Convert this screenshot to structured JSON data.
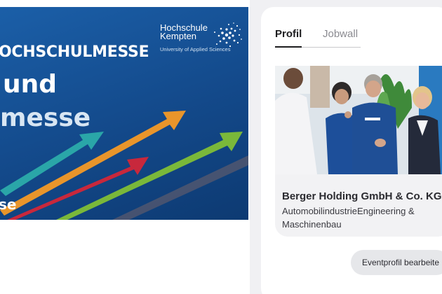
{
  "banner": {
    "heading": "OCHSCHULMESSE",
    "line1": "und",
    "line2": "messe",
    "bottom": "se",
    "logo": {
      "name": "Hochschule Kempten",
      "subtitle": "University of Applied Sciences"
    }
  },
  "tabs": [
    {
      "label": "Profil",
      "active": true
    },
    {
      "label": "Jobwall",
      "active": false
    }
  ],
  "company": {
    "name": "Berger Holding GmbH & Co. KG",
    "tags": "AutomobilindustrieEngineering & Maschinenbau"
  },
  "actions": {
    "edit_label": "Eventprofil bearbeite"
  },
  "colors": {
    "banner_blue": "#13498a",
    "card_bg": "#f2f2f4",
    "button_bg": "#e6e7ea",
    "arrow_orange": "#e8952b",
    "arrow_teal": "#2aa6a8",
    "arrow_red": "#c8283c",
    "arrow_green": "#7ab83a"
  }
}
